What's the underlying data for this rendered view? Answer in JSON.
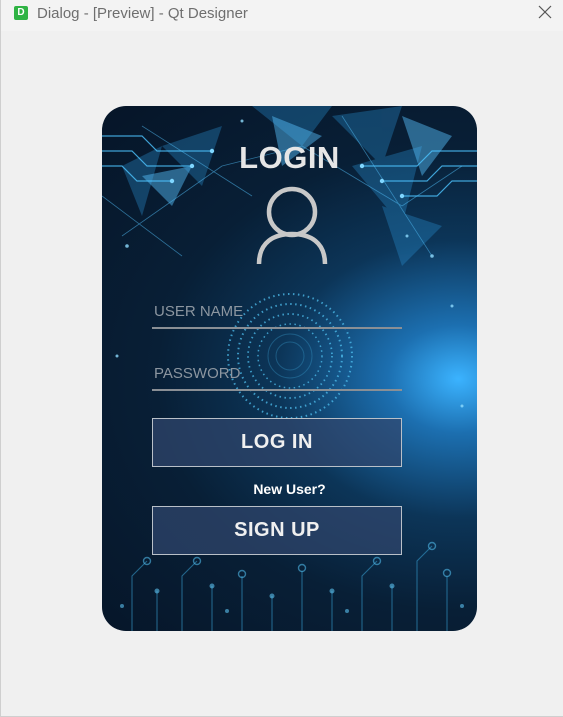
{
  "window": {
    "title": "Dialog - [Preview] - Qt Designer",
    "icon_letter": "D",
    "icons": {
      "app": "designer-app-icon",
      "close": "close-icon"
    }
  },
  "login": {
    "title": "LOGIN",
    "username_placeholder": "USER NAME",
    "password_placeholder": "PASSWORD",
    "login_button": "LOG IN",
    "new_user_text": "New User?",
    "signup_button": "SIGN UP",
    "icons": {
      "user": "user-icon"
    }
  },
  "colors": {
    "card_bg_dark": "#061528",
    "card_glow": "#3bb3ff",
    "button_bg": "#30466e",
    "text_light": "#e6e6e6",
    "field_underline": "#8a8f95"
  }
}
